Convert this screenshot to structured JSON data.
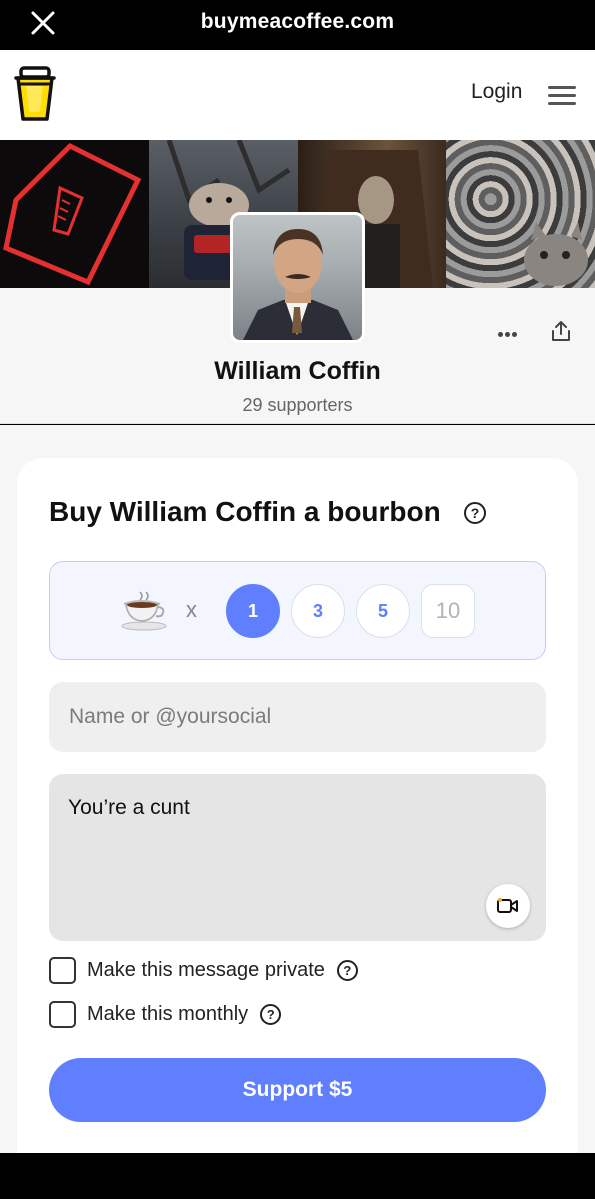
{
  "browser": {
    "url": "buymeacoffee.com"
  },
  "header": {
    "login_label": "Login"
  },
  "profile": {
    "name": "William Coffin",
    "supporters": "29 supporters"
  },
  "card": {
    "title": "Buy William Coffin a bourbon",
    "multiplier": "x",
    "quantities": [
      "1",
      "3",
      "5",
      "10"
    ],
    "selected_quantity": "1",
    "name_placeholder": "Name or @yoursocial",
    "message_value": "You’re a cunt",
    "private_label": "Make this message private",
    "monthly_label": "Make this monthly",
    "support_label": "Support $5"
  },
  "colors": {
    "accent": "#5f7fff",
    "logo_cup": "#ffdd00"
  }
}
